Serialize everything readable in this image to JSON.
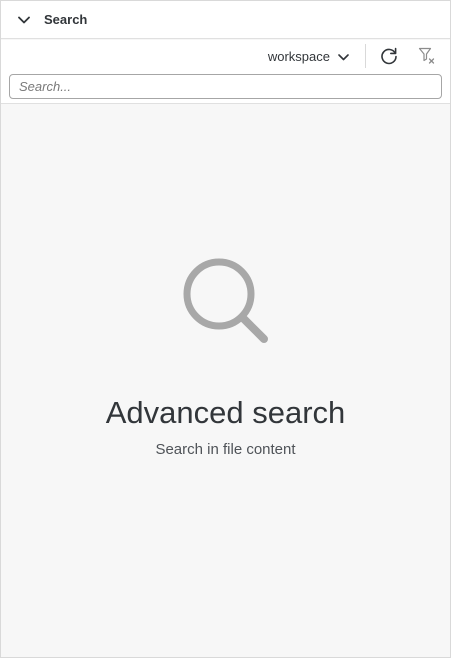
{
  "panel": {
    "title": "Search"
  },
  "toolbar": {
    "scope_value": "workspace",
    "refresh_icon": "refresh-icon",
    "clear_filter_icon": "clear-filter-icon"
  },
  "search": {
    "placeholder": "Search...",
    "value": ""
  },
  "empty_state": {
    "icon": "search-icon",
    "title": "Advanced search",
    "subtitle": "Search in file content"
  }
}
